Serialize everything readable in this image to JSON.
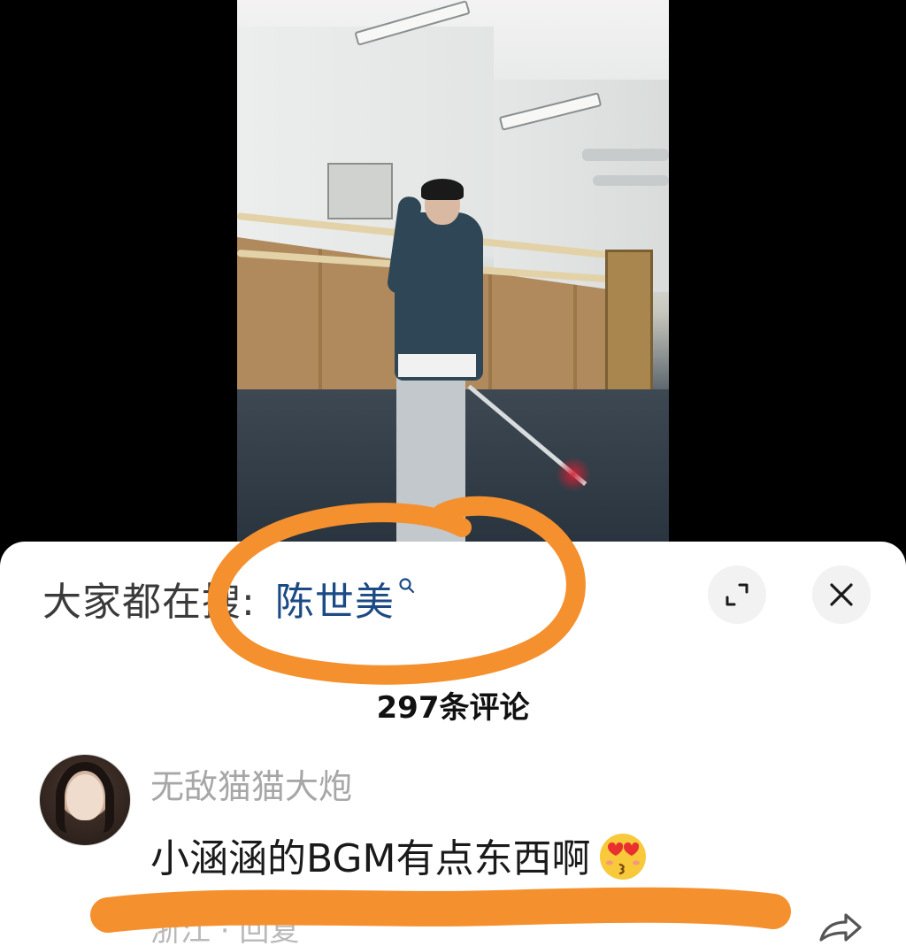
{
  "search_bar": {
    "prefix": "大家都在搜:",
    "term": "陈世美",
    "search_icon": "search-icon"
  },
  "controls": {
    "expand_icon": "expand-icon",
    "close_icon": "close-icon"
  },
  "comments": {
    "count_label": "297条评论",
    "items": [
      {
        "username": "无敌猫猫大炮",
        "text": "小涵涵的BGM有点东西啊",
        "emoji": "kissing-heart-eyes-emoji",
        "meta": "浙江 · 回复",
        "share_icon": "share-icon"
      }
    ]
  },
  "colors": {
    "search_term": "#1c4a84",
    "annotation": "#f5902e",
    "username": "#a7a7a7"
  }
}
